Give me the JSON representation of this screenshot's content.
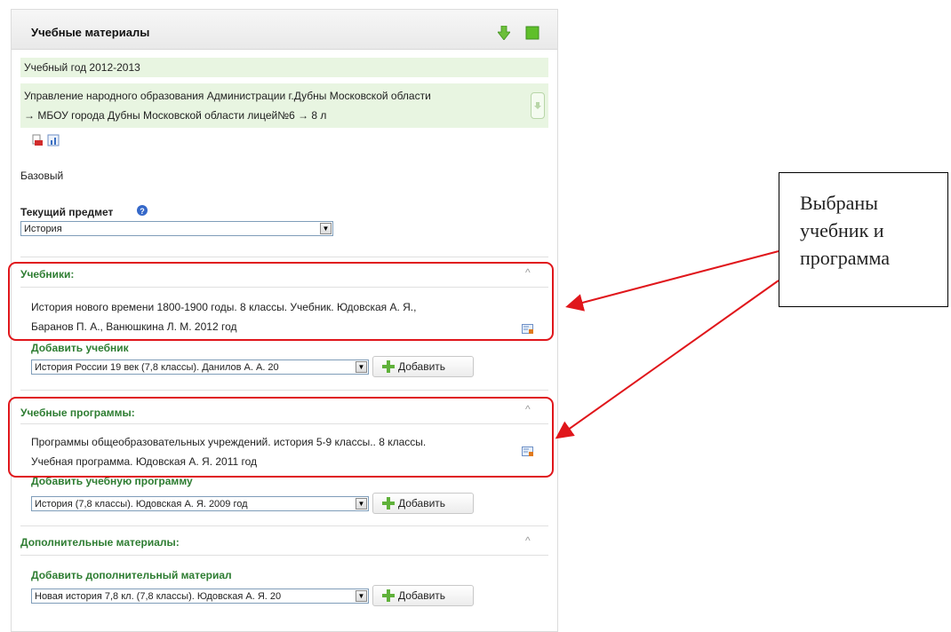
{
  "panel": {
    "title": "Учебные материалы",
    "academic_year": "Учебный год 2012-2013",
    "breadcrumb_line1": "Управление народного образования Администрации г.Дубны Московской области",
    "breadcrumb_line2": "→ МБОУ города Дубны Московской области лицей№6 → 8 л",
    "level": "Базовый",
    "current_subject_label": "Текущий предмет",
    "current_subject_value": "История",
    "icons": {
      "download": "green-down-arrow-icon",
      "window": "green-square-icon",
      "pdf": "pdf-icon",
      "chart": "chart-icon",
      "help": "help-icon",
      "edit": "edit-card-icon"
    }
  },
  "textbooks": {
    "title": "Учебники:",
    "item_line1": "История нового времени 1800-1900 годы. 8 классы. Учебник. Юдовская А. Я.,",
    "item_line2": "Баранов П. А., Ванюшкина Л. М. 2012 год",
    "add_label": "Добавить учебник",
    "select_value": "История России 19 век (7,8 классы). Данилов А. А. 20",
    "add_button": "Добавить"
  },
  "programs": {
    "title": "Учебные программы:",
    "item_line1": "Программы общеобразовательных учреждений. история 5-9 классы.. 8 классы.",
    "item_line2": "Учебная программа. Юдовская А. Я. 2011 год",
    "add_label": "Добавить учебную программу",
    "select_value": "История (7,8 классы). Юдовская А. Я. 2009 год",
    "add_button": "Добавить"
  },
  "extra": {
    "title": "Дополнительные материалы:",
    "add_label": "Добавить дополнительный материал",
    "select_value": "Новая история 7,8 кл. (7,8 классы). Юдовская А. Я. 20",
    "add_button": "Добавить"
  },
  "callout": {
    "line1": "Выбраны",
    "line2": "учебник и",
    "line3": "программа"
  },
  "colors": {
    "accent_green": "#2e7d32",
    "highlight_red": "#e0161b",
    "bar_green": "#e8f5e1"
  }
}
